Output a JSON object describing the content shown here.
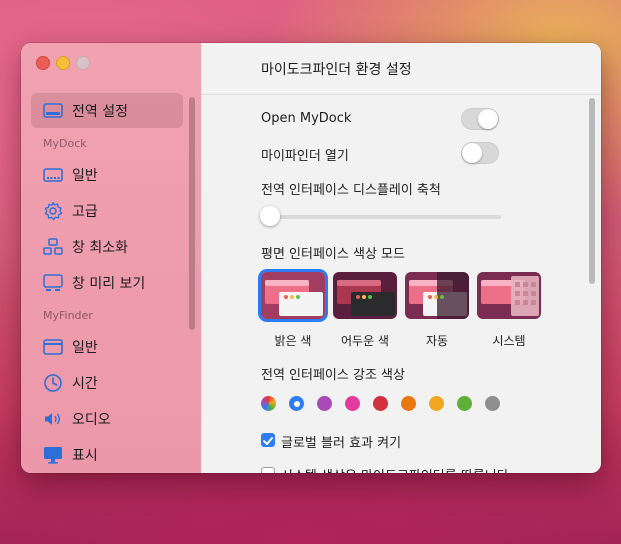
{
  "sidebar": {
    "items": [
      {
        "label": "전역 설정",
        "icon": "display-icon"
      },
      {
        "label": "일반",
        "icon": "dock-icon"
      },
      {
        "label": "고급",
        "icon": "gear-icon"
      },
      {
        "label": "창 최소화",
        "icon": "minimize-windows-icon"
      },
      {
        "label": "창 미리 보기",
        "icon": "window-preview-icon"
      },
      {
        "label": "일반",
        "icon": "finder-window-icon"
      },
      {
        "label": "시간",
        "icon": "clock-icon"
      },
      {
        "label": "오디오",
        "icon": "speaker-icon"
      },
      {
        "label": "표시",
        "icon": "monitor-icon"
      }
    ],
    "sections": [
      "MyDock",
      "MyFinder"
    ]
  },
  "main": {
    "title": "마이도크파인더 환경 설정",
    "open_mydock_label": "Open MyDock",
    "open_mydock_on": true,
    "open_myfinder_label": "마이파인더 열기",
    "open_myfinder_on": false,
    "scale_label": "전역 인터페이스 디스플레이 축척",
    "scale_value": 0,
    "appearance_label": "평면 인터페이스 색상 모드",
    "themes": [
      "밝은 색",
      "어두운 색",
      "자동",
      "시스템"
    ],
    "selected_theme": "밝은 색",
    "accent_label": "전역 인터페이스 강조 색상",
    "accent_colors": [
      "multicolor",
      "#2d7cf6",
      "#a84bb5",
      "#e23a9d",
      "#d2303e",
      "#e8770f",
      "#f2a623",
      "#5fae36",
      "#8e8e8e"
    ],
    "selected_accent": "#2d7cf6",
    "blur_label": "글로벌 블러 효과 켜기",
    "blur_on": true,
    "system_color_label": "시스템 색상은 마이도크파인더를 따릅니다",
    "system_color_on": false
  },
  "colors": {
    "accent": "#2d7cf6",
    "sidebar_bg": "#ef9eae"
  }
}
